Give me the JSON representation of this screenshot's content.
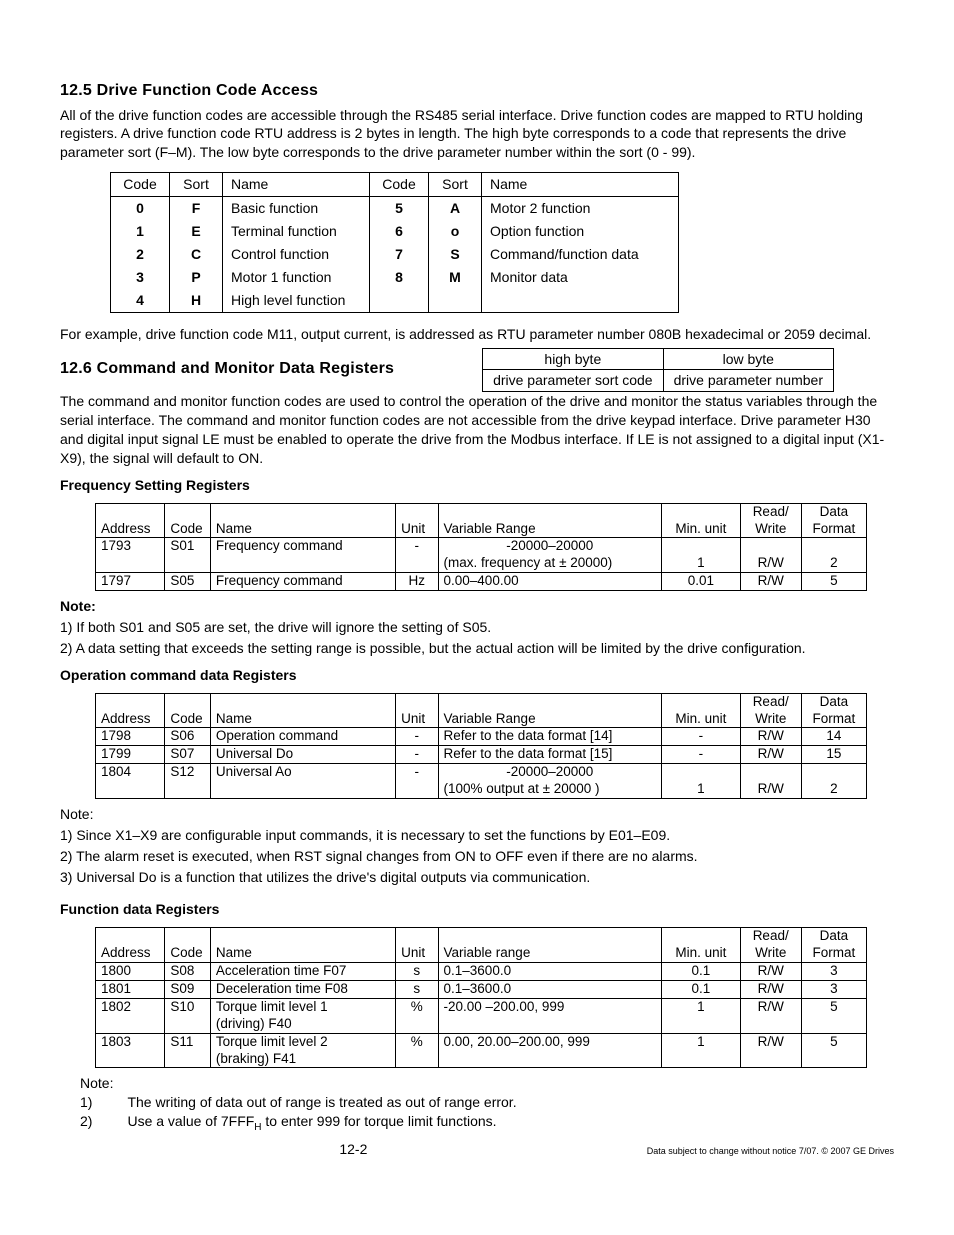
{
  "s125": {
    "title": "12.5  Drive Function Code Access",
    "para": "All of the drive function codes are accessible through the RS485 serial interface.  Drive function codes are mapped to RTU holding registers.  A drive function code RTU address is 2 bytes in length. The high byte corresponds to a code that represents the drive parameter sort (F–M).  The low byte corresponds to the drive parameter number within the sort (0 - 99)."
  },
  "codesort": {
    "hdr": {
      "code": "Code",
      "sort": "Sort",
      "name": "Name"
    },
    "left": [
      {
        "code": "0",
        "sort": "F",
        "name": "Basic function"
      },
      {
        "code": "1",
        "sort": "E",
        "name": "Terminal function"
      },
      {
        "code": "2",
        "sort": "C",
        "name": "Control function"
      },
      {
        "code": "3",
        "sort": "P",
        "name": "Motor 1 function"
      },
      {
        "code": "4",
        "sort": "H",
        "name": "High level function"
      }
    ],
    "right": [
      {
        "code": "5",
        "sort": "A",
        "name": "Motor 2 function"
      },
      {
        "code": "6",
        "sort": "o",
        "name": "Option function"
      },
      {
        "code": "7",
        "sort": "S",
        "name": "Command/function data"
      },
      {
        "code": "8",
        "sort": "M",
        "name": "Monitor data"
      },
      {
        "code": "",
        "sort": "",
        "name": ""
      }
    ]
  },
  "example": "For example, drive function code M11, output current, is addressed as RTU parameter number 080B hexadecimal or 2059 decimal.",
  "bytebox": {
    "r1c1": "high byte",
    "r1c2": "low byte",
    "r2c1": "drive parameter sort code",
    "r2c2": "drive parameter number"
  },
  "s126": {
    "title": "12.6  Command and Monitor Data Registers",
    "para": "The command and monitor function codes are used to control the operation of the drive and monitor the status variables through the serial interface.  The command and monitor function codes are not accessible from the drive keypad interface. Drive parameter H30 and digital input signal LE must be enabled to operate the drive from the Modbus interface. If LE is not assigned to a digital input (X1-X9), the signal will default to ON."
  },
  "hdrs": {
    "addr": "Address",
    "code": "Code",
    "name": "Name",
    "unit": "Unit",
    "range": "Variable Range",
    "range2": "Variable range",
    "minu": "Min. unit",
    "rw1": "Read/",
    "rw2": "Write",
    "fmt1": "Data",
    "fmt2": "Format"
  },
  "freq": {
    "title": "Frequency Setting Registers",
    "rows": [
      {
        "addr": "1793",
        "code": "S01",
        "name": "Frequency command",
        "unit": "-",
        "range": "-20000–20000",
        "range2": "(max. frequency at ± 20000)",
        "minu": "1",
        "rw": "R/W",
        "fmt": "2"
      },
      {
        "addr": "1797",
        "code": "S05",
        "name": "Frequency command",
        "unit": "Hz",
        "range": "0.00–400.00",
        "range2": "",
        "minu": "0.01",
        "rw": "R/W",
        "fmt": "5"
      }
    ],
    "notehdr": "Note:",
    "note1": "1) If both S01 and S05 are set, the drive will ignore the setting of S05.",
    "note2": "2) A data setting that exceeds the setting range is possible, but the actual action will be limited by the drive configuration."
  },
  "op": {
    "title": "Operation command data Registers",
    "rows": [
      {
        "addr": "1798",
        "code": "S06",
        "name": "Operation command",
        "unit": "-",
        "range": "Refer to the data format [14]",
        "minu": "-",
        "rw": "R/W",
        "fmt": "14"
      },
      {
        "addr": "1799",
        "code": "S07",
        "name": "Universal Do",
        "unit": "-",
        "range": "Refer to the data format [15]",
        "minu": "-",
        "rw": "R/W",
        "fmt": "15"
      },
      {
        "addr": "1804",
        "code": "S12",
        "name": "Universal Ao",
        "unit": "-",
        "range": "-20000–20000",
        "range2": "(100% output at ± 20000 )",
        "minu": "1",
        "rw": "R/W",
        "fmt": "2"
      }
    ],
    "notehdr": "Note:",
    "note1": "1) Since X1–X9 are configurable input commands, it is necessary to set the functions by E01–E09.",
    "note2": "2) The alarm reset is executed, when RST signal changes from ON to OFF even if there are no alarms.",
    "note3": "3) Universal Do is a function that utilizes the drive's digital outputs via communication."
  },
  "func": {
    "title": "Function data Registers",
    "rows": [
      {
        "addr": "1800",
        "code": "S08",
        "name": "Acceleration time  F07",
        "unit": "s",
        "range": "0.1–3600.0",
        "minu": "0.1",
        "rw": "R/W",
        "fmt": "3"
      },
      {
        "addr": "1801",
        "code": "S09",
        "name": "Deceleration time F08",
        "unit": "s",
        "range": "0.1–3600.0",
        "minu": "0.1",
        "rw": "R/W",
        "fmt": "3"
      },
      {
        "addr": "1802",
        "code": "S10",
        "name": "Torque limit level 1",
        "name2": "(driving) F40",
        "unit": "%",
        "range": "-20.00 –200.00, 999",
        "minu": "1",
        "rw": "R/W",
        "fmt": "5"
      },
      {
        "addr": "1803",
        "code": "S11",
        "name": "Torque limit level 2",
        "name2": "(braking) F41",
        "unit": "%",
        "range": "0.00, 20.00–200.00, 999",
        "minu": "1",
        "rw": "R/W",
        "fmt": "5"
      }
    ]
  },
  "footnotes": {
    "hdr": "Note:",
    "n1a": "1)",
    "n1b": "The writing of data out of range is treated as out of range error.",
    "n2a": "2)",
    "n2b_pre": "Use a value of 7FFF",
    "n2b_sub": "H",
    "n2b_post": " to enter 999 for torque limit functions."
  },
  "pagefoot": {
    "center": "12-2",
    "right": "Data subject to change without notice 7/07. © 2007 GE Drives"
  }
}
